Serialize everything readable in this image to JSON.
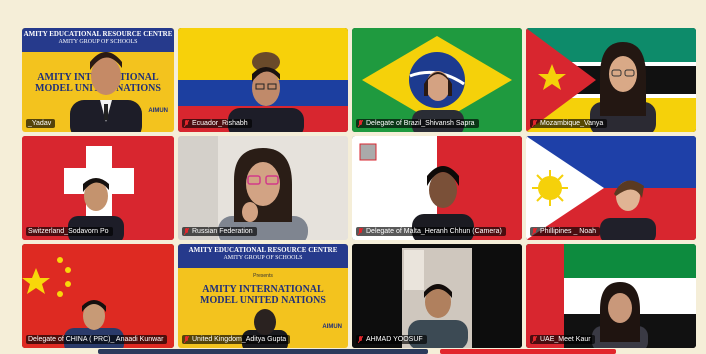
{
  "banner": {
    "line1": "AMITY EDUCATIONAL RESOURCE CENTRE",
    "line2": "Together with",
    "line3": "AMITY GROUP OF SCHOOLS",
    "presents": "Presents",
    "mun1": "AMITY INTERNATIONAL",
    "mun2": "MODEL UNITED NATIONS",
    "badge": "AIMUN"
  },
  "participants": [
    {
      "label": "_Yadav",
      "muted": false
    },
    {
      "label": "Ecuador_Rishabh",
      "muted": true
    },
    {
      "label": "Delegate of Brazil_Shivansh Sapra",
      "muted": true
    },
    {
      "label": "Mozambique_Vanya",
      "muted": true
    },
    {
      "label": "Switzerland_Sodavorn Po",
      "muted": false
    },
    {
      "label": "Russian Federation",
      "muted": true
    },
    {
      "label": "Delegate of Malta_Heranh Chhun (Camera)",
      "muted": true
    },
    {
      "label": "Phillipines _ Noah",
      "muted": true
    },
    {
      "label": "Delegate of CHINA ( PRC)_ Anaadi Kunwar",
      "muted": false
    },
    {
      "label": "United Kingdom_Aditya Gupta",
      "muted": true
    },
    {
      "label": "AHMAD YOOSUF",
      "muted": true
    },
    {
      "label": "UAE_Meet Kaur",
      "muted": true
    }
  ],
  "colors": {
    "muted_mic": "#e2262c",
    "banner_blue": "#263a8c",
    "banner_yellow": "#f3c31e"
  }
}
